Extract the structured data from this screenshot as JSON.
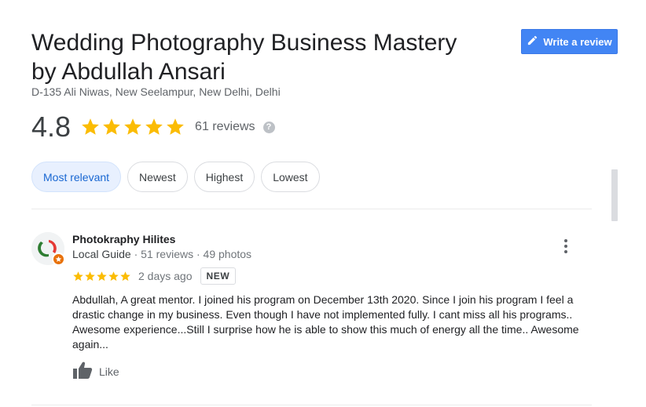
{
  "business": {
    "title": "Wedding Photography Business Mastery by Abdullah Ansari",
    "address": "D-135 Ali Niwas, New Seelampur, New Delhi, Delhi"
  },
  "write_review": {
    "label": "Write a review",
    "icon": "pencil-icon",
    "color": "#4285f4"
  },
  "summary": {
    "rating": "4.8",
    "stars": 5,
    "review_count": "61 reviews",
    "star_color": "#fbbc04",
    "help_icon": "help-icon"
  },
  "sort_chips": [
    {
      "label": "Most relevant",
      "selected": true
    },
    {
      "label": "Newest",
      "selected": false
    },
    {
      "label": "Highest",
      "selected": false
    },
    {
      "label": "Lowest",
      "selected": false
    }
  ],
  "reviews": [
    {
      "author": "Photokraphy Hilites",
      "guide_label": "Local Guide",
      "review_stats": "51 reviews",
      "photo_stats": "49 photos",
      "stars": 5,
      "date": "2 days ago",
      "badge": "NEW",
      "text": "Abdullah, A great mentor. I joined his program on December 13th 2020. Since I join his program I feel a drastic change in my business. Even though I have not implemented fully. I cant miss all his programs.. Awesome experience...Still I surprise how he is able to show this much of energy all the time.. Awesome again...",
      "like_label": "Like"
    }
  ]
}
